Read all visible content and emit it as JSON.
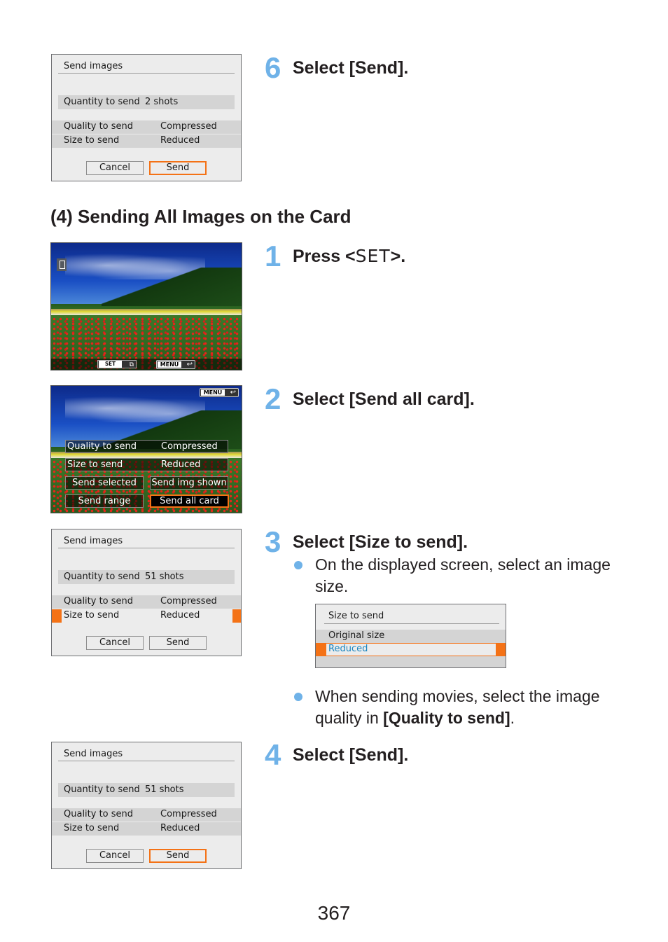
{
  "steps_top": {
    "step6": {
      "number": "6",
      "title": "Select [Send]."
    }
  },
  "section": {
    "heading": "(4) Sending All Images on the Card"
  },
  "steps": [
    {
      "number": "1",
      "title_prefix": "Press <",
      "title_key": "SET",
      "title_suffix": ">."
    },
    {
      "number": "2",
      "title": "Select [Send all card]."
    },
    {
      "number": "3",
      "title": "Select [Size to send].",
      "bullets": [
        {
          "text": "On the displayed screen, select an image size."
        },
        {
          "text_prefix": "When sending movies, select the image quality in ",
          "text_bold": "[Quality to send]",
          "text_suffix": "."
        }
      ]
    },
    {
      "number": "4",
      "title": "Select [Send]."
    }
  ],
  "screens": {
    "send_dialog_1": {
      "title": "Send images",
      "quantity_label": "Quantity to send",
      "quantity_value": "2 shots",
      "quality_label": "Quality to send",
      "quality_value": "Compressed",
      "size_label": "Size to send",
      "size_value": "Reduced",
      "cancel": "Cancel",
      "send": "Send",
      "focused": "send"
    },
    "playback": {
      "set_key": "SET",
      "menu_key": "MENU",
      "icons": [
        "smartphone-icon",
        "send-icon",
        "return-icon"
      ]
    },
    "send_options": {
      "menu_key": "MENU",
      "quality_label": "Quality to send",
      "quality_value": "Compressed",
      "size_label": "Size to send",
      "size_value": "Reduced",
      "send_selected": "Send selected",
      "send_img_shown": "Send img shown",
      "send_range": "Send range",
      "send_all_card": "Send all card",
      "focused": "send_all_card"
    },
    "send_dialog_2": {
      "title": "Send images",
      "quantity_label": "Quantity to send",
      "quantity_value": "51 shots",
      "quality_label": "Quality to send",
      "quality_value": "Compressed",
      "size_label": "Size to send",
      "size_value": "Reduced",
      "cancel": "Cancel",
      "send": "Send",
      "focused": "size_to_send"
    },
    "size_menu": {
      "title": "Size to send",
      "options": [
        "Original size",
        "Reduced"
      ],
      "selected": "Reduced"
    },
    "send_dialog_3": {
      "title": "Send images",
      "quantity_label": "Quantity to send",
      "quantity_value": "51 shots",
      "quality_label": "Quality to send",
      "quality_value": "Compressed",
      "size_label": "Size to send",
      "size_value": "Reduced",
      "cancel": "Cancel",
      "send": "Send",
      "focused": "send"
    }
  },
  "colors": {
    "step_number": "#6fb2e8",
    "focus": "#f47216",
    "selected_text": "#1a86c0"
  },
  "page_number": "367"
}
